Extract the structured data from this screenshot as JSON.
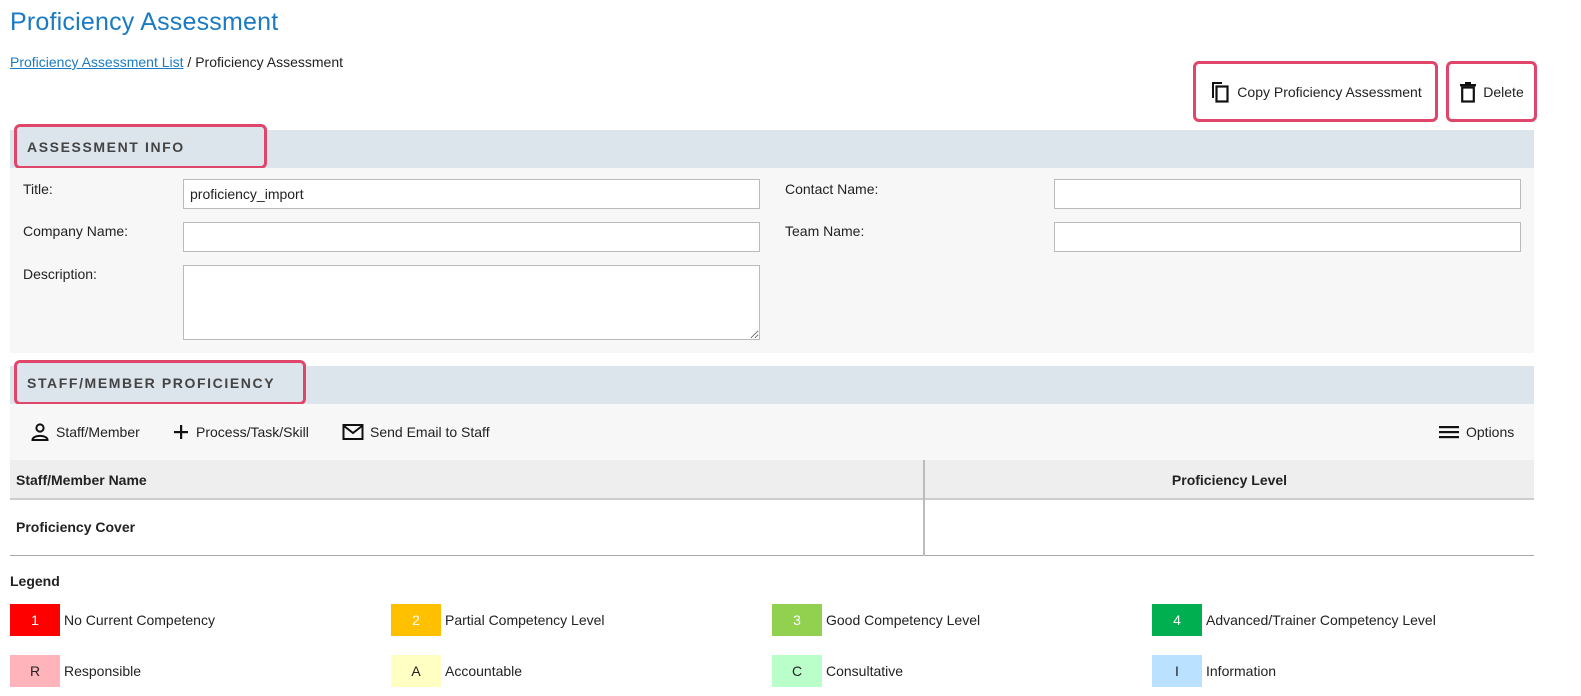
{
  "page": {
    "title": "Proficiency Assessment",
    "breadcrumb": {
      "link": "Proficiency Assessment List",
      "separator": "/",
      "current": "Proficiency Assessment"
    }
  },
  "actions": {
    "copy_label": "Copy Proficiency Assessment",
    "delete_label": "Delete",
    "highlight_color": "#e0456a"
  },
  "assessment_info": {
    "header": "ASSESSMENT INFO",
    "fields": {
      "title": {
        "label": "Title:",
        "value": "proficiency_import"
      },
      "contact_name": {
        "label": "Contact Name:",
        "value": ""
      },
      "company_name": {
        "label": "Company Name:",
        "value": ""
      },
      "team_name": {
        "label": "Team Name:",
        "value": ""
      },
      "description": {
        "label": "Description:",
        "value": ""
      }
    }
  },
  "staff_proficiency": {
    "header": "STAFF/MEMBER PROFICIENCY",
    "toolbar": {
      "staff_member": "Staff/Member",
      "process_task_skill": "Process/Task/Skill",
      "send_email": "Send Email to Staff",
      "options": "Options"
    },
    "grid": {
      "columns": [
        "Staff/Member Name",
        "Proficiency Level"
      ],
      "rows": [
        "Proficiency Cover"
      ]
    }
  },
  "legend": {
    "title": "Legend",
    "items": [
      {
        "code": "1",
        "label": "No Current Competency",
        "color": "#ff0000",
        "text_color": "#ffffff"
      },
      {
        "code": "2",
        "label": "Partial Competency Level",
        "color": "#ffc000",
        "text_color": "#ffffff"
      },
      {
        "code": "3",
        "label": "Good Competency Level",
        "color": "#92d050",
        "text_color": "#ffffff"
      },
      {
        "code": "4",
        "label": "Advanced/Trainer Competency Level",
        "color": "#00b050",
        "text_color": "#ffffff"
      },
      {
        "code": "R",
        "label": "Responsible",
        "color": "#ffb3ba",
        "text_color": "#222222"
      },
      {
        "code": "A",
        "label": "Accountable",
        "color": "#ffffc4",
        "text_color": "#222222"
      },
      {
        "code": "C",
        "label": "Consultative",
        "color": "#baffc9",
        "text_color": "#222222"
      },
      {
        "code": "I",
        "label": "Information",
        "color": "#bae1ff",
        "text_color": "#222222"
      }
    ]
  }
}
